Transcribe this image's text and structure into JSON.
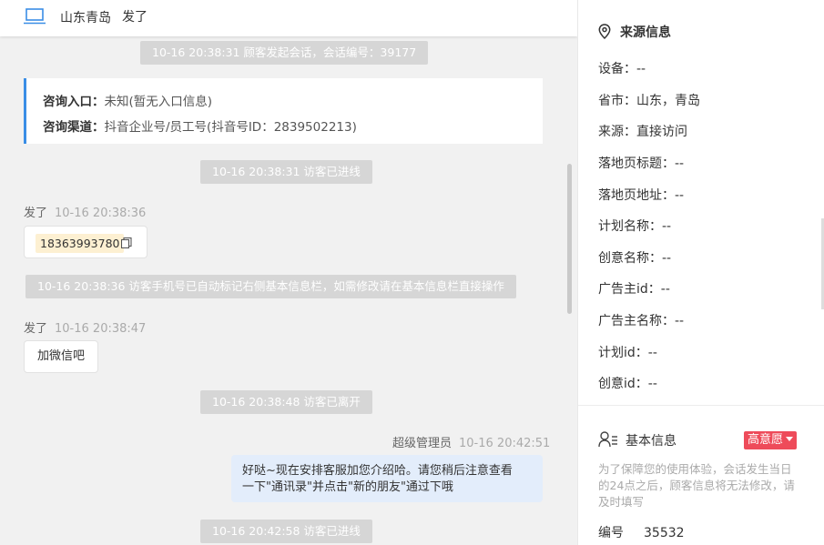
{
  "header": {
    "location": "山东青岛",
    "visitor_name": "发了"
  },
  "chat": {
    "system_session_start": "10-16 20:38:31 顾客发起会话，会话编号：39177",
    "consult": {
      "entry_label": "咨询入口：",
      "entry_value": "未知(暂无入口信息)",
      "channel_label": "咨询渠道：",
      "channel_value": "抖音企业号/员工号(抖音号ID：2839502213)"
    },
    "system_enter_1": "10-16 20:38:31 访客已进线",
    "msg1": {
      "sender": "发了",
      "time": "10-16 20:38:36",
      "text": "18363993780"
    },
    "system_auto_mark": "10-16 20:38:36 访客手机号已自动标记右侧基本信息栏，如需修改请在基本信息栏直接操作",
    "msg2": {
      "sender": "发了",
      "time": "10-16 20:38:47",
      "text": "加微信吧"
    },
    "system_leave": "10-16 20:38:48 访客已离开",
    "agent_msg": {
      "sender": "超级管理员",
      "time": "10-16 20:42:51",
      "line1": "好哒~现在安排客服加您介绍哈。请您稍后注意查看",
      "line2": "一下\"通讯录\"并点击\"新的朋友\"通过下哦"
    },
    "system_enter_2": "10-16 20:42:58 访客已进线"
  },
  "source_info": {
    "title": "来源信息",
    "rows": [
      "设备：--",
      "省市：山东，青岛",
      "来源：直接访问",
      "落地页标题：--",
      "落地页地址：--",
      "计划名称：--",
      "创意名称：--",
      "广告主id：--",
      "广告主名称：--",
      "计划id：--",
      "创意id：--"
    ]
  },
  "basic_info": {
    "title": "基本信息",
    "intent_badge": "高意愿",
    "notice": "为了保障您的使用体验，会话发生当日的24点之后，顾客信息将无法修改，请及时填写",
    "code_label": "编号",
    "code_value": "35532"
  },
  "colors": {
    "accent": "#3a8ee6",
    "intent_red": "#ee4b5a",
    "agent_bubble": "#e3edfb",
    "phone_highlight": "#fdf0d2"
  }
}
